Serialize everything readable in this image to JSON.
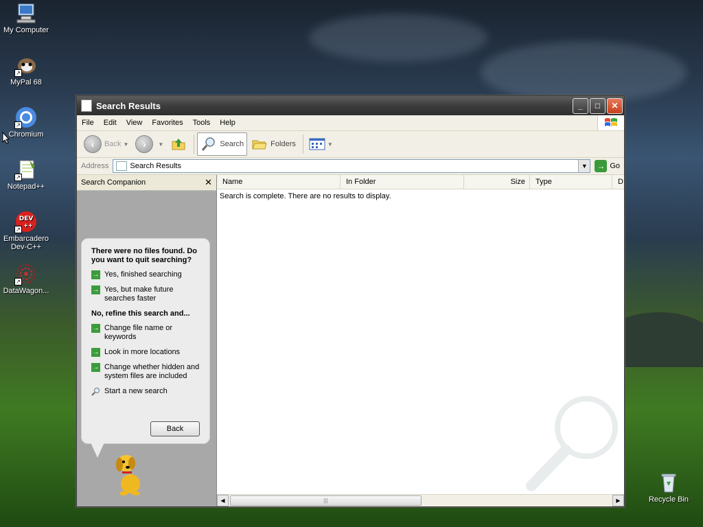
{
  "desktop": {
    "icons": [
      {
        "label": "My Computer",
        "icon": "computer-icon"
      },
      {
        "label": "MyPal 68",
        "icon": "mypal-icon"
      },
      {
        "label": "Chromium",
        "icon": "chromium-icon"
      },
      {
        "label": "Notepad++",
        "icon": "notepadpp-icon"
      },
      {
        "label": "Embarcadero Dev-C++",
        "icon": "devcpp-icon"
      },
      {
        "label": "DataWagon...",
        "icon": "datawagon-icon"
      },
      {
        "label": "Recycle Bin",
        "icon": "recycle-bin-icon"
      }
    ]
  },
  "window": {
    "title": "Search Results",
    "menu": [
      "File",
      "Edit",
      "View",
      "Favorites",
      "Tools",
      "Help"
    ],
    "toolbar": {
      "back": "Back",
      "search": "Search",
      "folders": "Folders"
    },
    "address": {
      "label": "Address",
      "value": "Search Results",
      "go": "Go"
    }
  },
  "companion": {
    "header": "Search Companion",
    "close": "✕",
    "question": "There were no files found. Do you want to quit searching?",
    "quit_options": [
      "Yes, finished searching",
      "Yes, but make future searches faster"
    ],
    "refine_heading": "No, refine this search and...",
    "refine_options": [
      "Change file name or keywords",
      "Look in more locations",
      "Change whether hidden and system files are included"
    ],
    "new_search": "Start a new search",
    "back_button": "Back"
  },
  "results": {
    "columns": [
      "Name",
      "In Folder",
      "Size",
      "Type",
      "D"
    ],
    "message": "Search is complete. There are no results to display."
  },
  "colors": {
    "title_bar": "#3d3d3d",
    "close_button": "#c8401c",
    "option_arrow": "#3c9c3c"
  }
}
